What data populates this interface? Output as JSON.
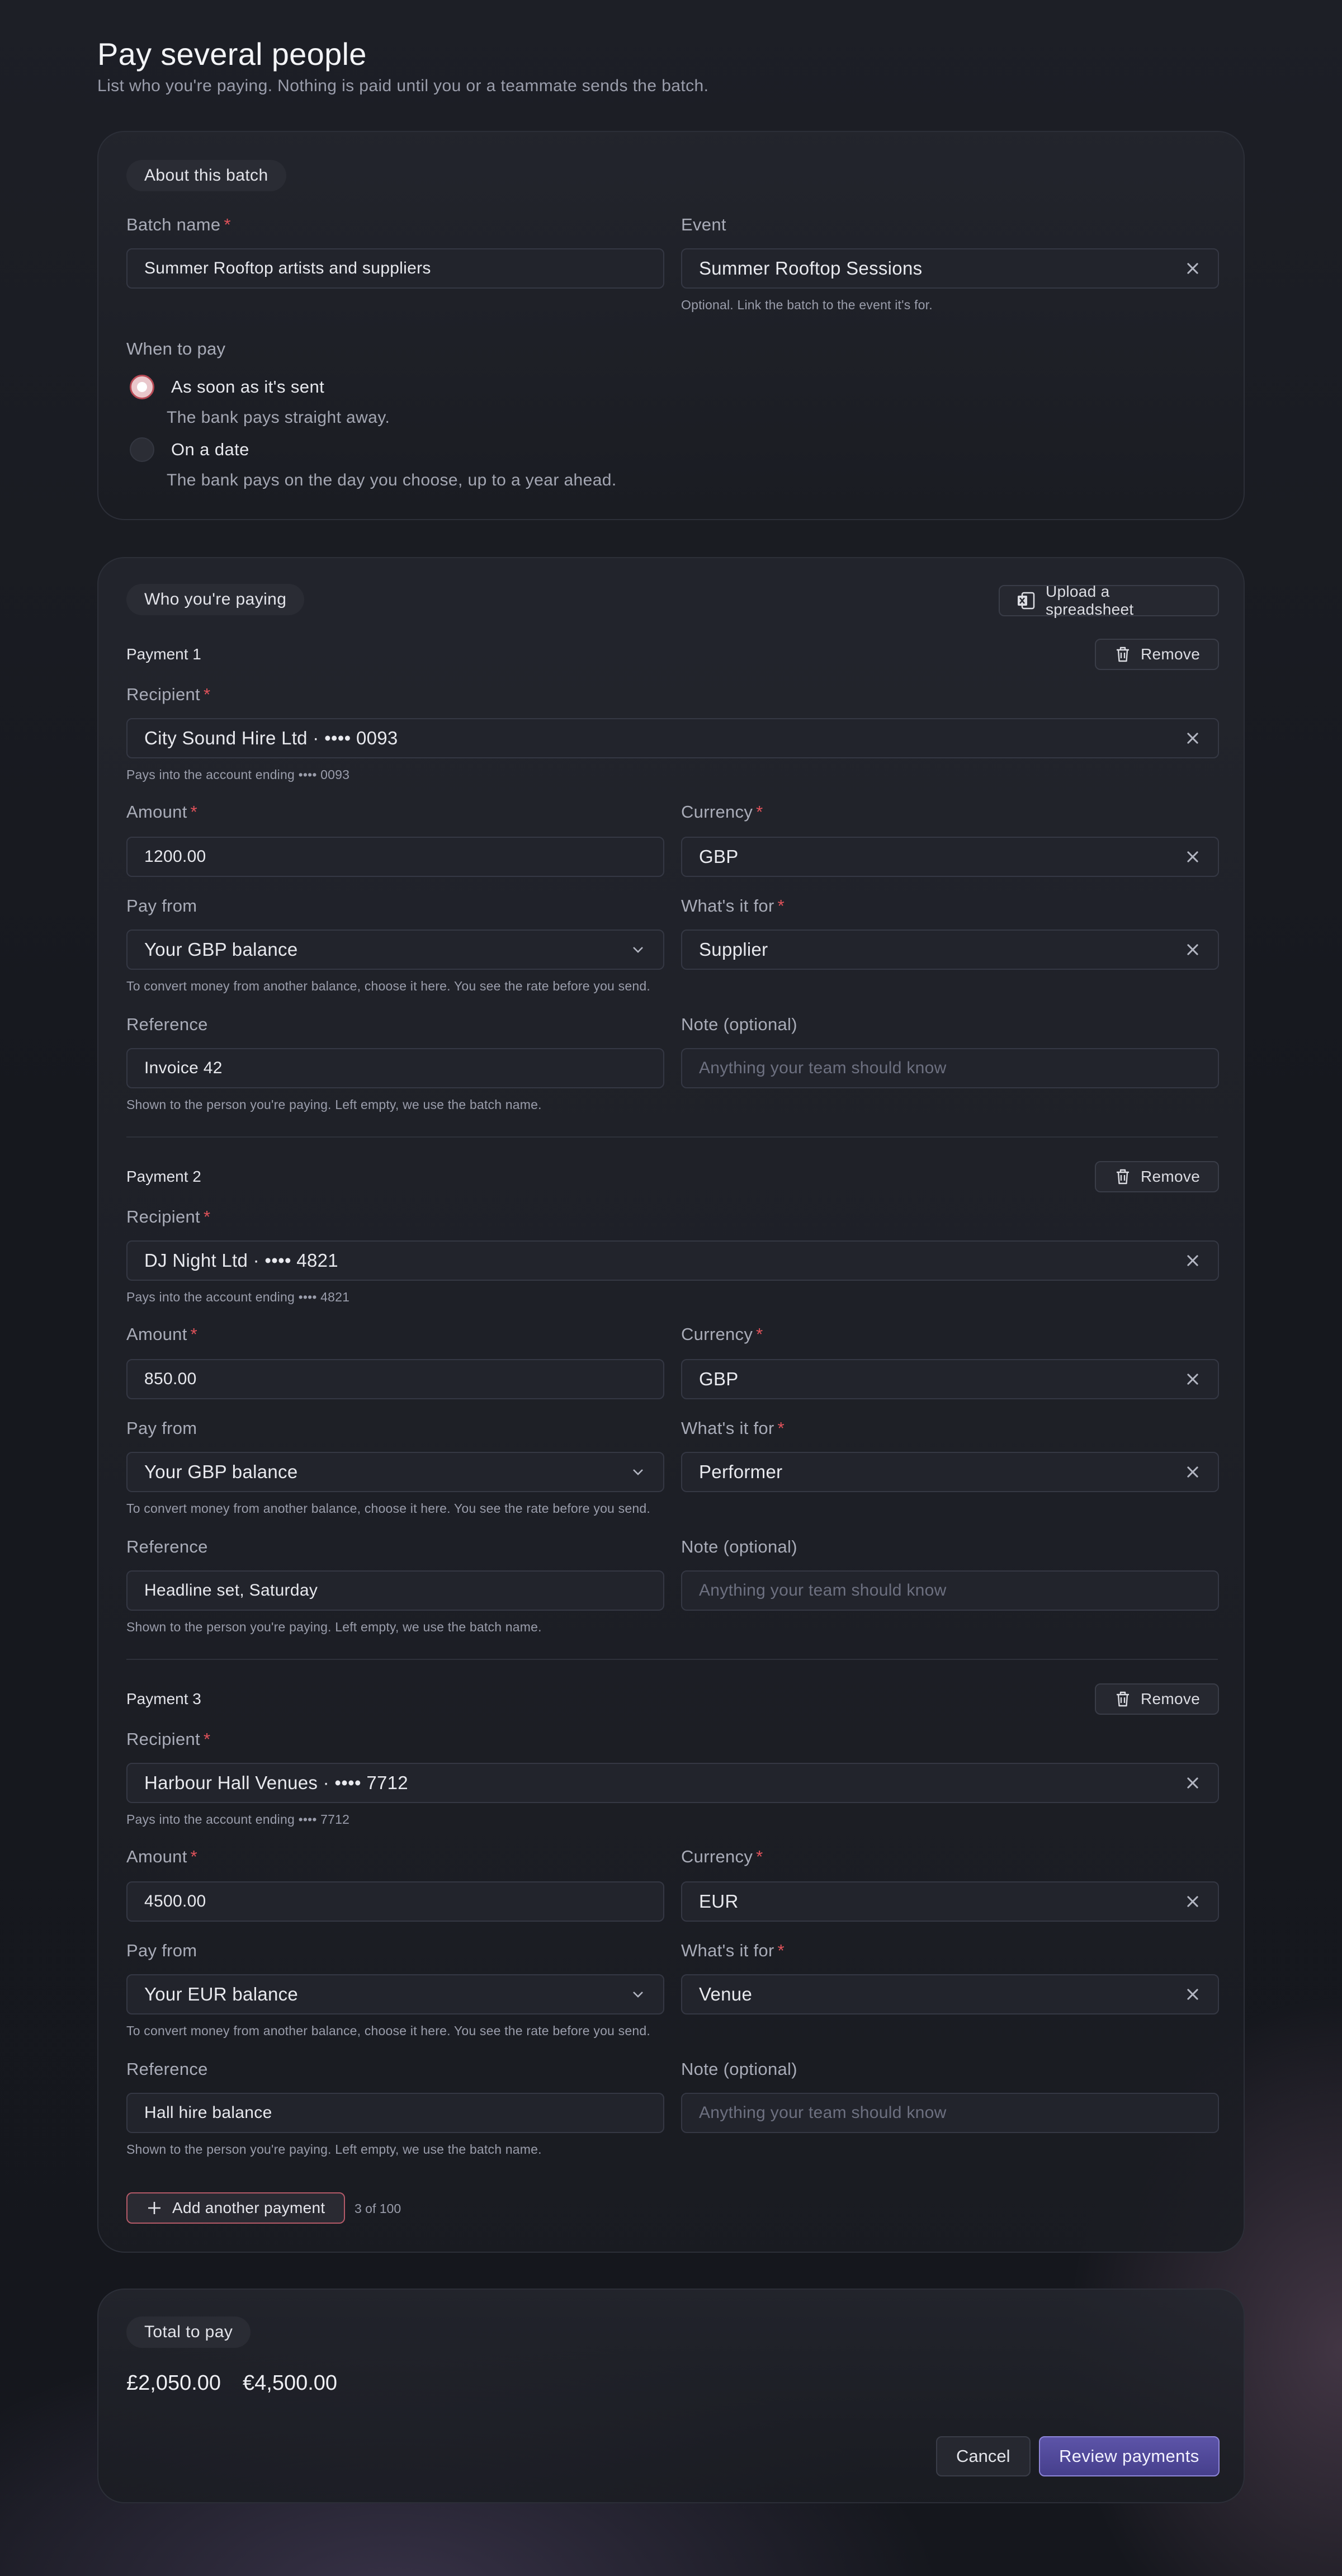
{
  "page": {
    "title": "Pay several people",
    "subtitle": "List who you're paying. Nothing is paid until you or a teammate sends the batch."
  },
  "about": {
    "section_label": "About this batch",
    "batch_name_label": "Batch name",
    "batch_name_value": "Summer Rooftop artists and suppliers",
    "event_label": "Event",
    "event_value": "Summer Rooftop Sessions",
    "event_hint": "Optional. Link the batch to the event it's for.",
    "when_label": "When to pay",
    "options": [
      {
        "label": "As soon as it's sent",
        "hint": "The bank pays straight away.",
        "selected": true
      },
      {
        "label": "On a date",
        "hint": "The bank pays on the day you choose, up to a year ahead.",
        "selected": false
      }
    ]
  },
  "payees": {
    "section_label": "Who you're paying",
    "upload_label": "Upload a spreadsheet",
    "remove_label": "Remove",
    "labels": {
      "recipient": "Recipient",
      "amount": "Amount",
      "currency": "Currency",
      "pay_from": "Pay from",
      "whats_it_for": "What's it for",
      "reference": "Reference",
      "note": "Note (optional)"
    },
    "note_placeholder": "Anything your team should know",
    "pay_from_hint": "To convert money from another balance, choose it here. You see the rate before you send.",
    "reference_hint": "Shown to the person you're paying. Left empty, we use the batch name.",
    "payments": [
      {
        "title": "Payment 1",
        "recipient": "City Sound Hire Ltd · •••• 0093",
        "recipient_hint": "Pays into the account ending •••• 0093",
        "amount": "1200.00",
        "currency": "GBP",
        "pay_from": "Your GBP balance",
        "purpose": "Supplier",
        "reference": "Invoice 42",
        "note": ""
      },
      {
        "title": "Payment 2",
        "recipient": "DJ Night Ltd · •••• 4821",
        "recipient_hint": "Pays into the account ending •••• 4821",
        "amount": "850.00",
        "currency": "GBP",
        "pay_from": "Your GBP balance",
        "purpose": "Performer",
        "reference": "Headline set, Saturday",
        "note": ""
      },
      {
        "title": "Payment 3",
        "recipient": "Harbour Hall Venues · •••• 7712",
        "recipient_hint": "Pays into the account ending •••• 7712",
        "amount": "4500.00",
        "currency": "EUR",
        "pay_from": "Your EUR balance",
        "purpose": "Venue",
        "reference": "Hall hire balance",
        "note": ""
      }
    ],
    "add_label": "Add another payment",
    "counter": "3 of 100"
  },
  "totals": {
    "section_label": "Total to pay",
    "gbp": "£2,050.00",
    "eur": "€4,500.00",
    "cancel_label": "Cancel",
    "review_label": "Review payments"
  },
  "colors": {
    "accent": "#5c54a8",
    "required": "#e0525a",
    "radio_selected": "#b84a55"
  }
}
